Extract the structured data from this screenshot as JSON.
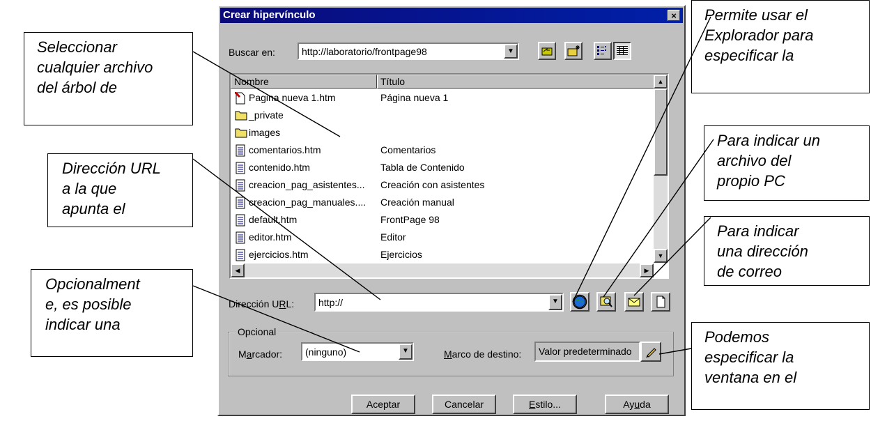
{
  "dialog": {
    "title": "Crear hipervínculo",
    "close_label": "×",
    "look_in_label": "Buscar en:",
    "look_in_value": "http://laboratorio/frontpage98",
    "toolbar_icons": [
      "up-folder-icon",
      "new-folder-icon",
      "list-view-icon",
      "details-view-icon"
    ],
    "columns": {
      "name": "Nombre",
      "title": "Título"
    },
    "files": [
      {
        "name": "Pagina nueva 1.htm",
        "title": "Página nueva 1",
        "icon": "page-icon"
      },
      {
        "name": "_private",
        "title": "",
        "icon": "folder-icon"
      },
      {
        "name": "images",
        "title": "",
        "icon": "folder-icon"
      },
      {
        "name": "comentarios.htm",
        "title": "Comentarios",
        "icon": "document-icon"
      },
      {
        "name": "contenido.htm",
        "title": "Tabla de Contenido",
        "icon": "document-icon"
      },
      {
        "name": "creacion_pag_asistentes...",
        "title": "Creación con asistentes",
        "icon": "document-icon"
      },
      {
        "name": "creacion_pag_manuales....",
        "title": "Creación manual",
        "icon": "document-icon"
      },
      {
        "name": "default.htm",
        "title": "FrontPage 98",
        "icon": "document-icon"
      },
      {
        "name": "editor.htm",
        "title": "Editor",
        "icon": "document-icon"
      },
      {
        "name": "ejercicios.htm",
        "title": "Ejercicios",
        "icon": "document-icon"
      }
    ],
    "url_label_pre": "Dirección U",
    "url_label_ul": "R",
    "url_label_post": "L:",
    "url_value": "http://",
    "optional_legend": "Opcional",
    "bookmark_label_pre": "M",
    "bookmark_label_ul": "a",
    "bookmark_label_post": "rcador:",
    "bookmark_value": "(ninguno)",
    "target_label_ul": "M",
    "target_label_post": "arco de destino:",
    "target_value": "Valor predeterminado",
    "buttons": {
      "ok": "Aceptar",
      "cancel": "Cancelar",
      "style_ul": "E",
      "style_post": "stilo...",
      "help_pre": "Ay",
      "help_ul": "u",
      "help_post": "da"
    }
  },
  "callouts": {
    "select_file": [
      "Seleccionar",
      "cualquier archivo",
      "del árbol de"
    ],
    "url": [
      "Dirección URL",
      "a la que",
      "apunta el"
    ],
    "optional": [
      "Opcionalment",
      "e, es posible",
      "indicar una"
    ],
    "browser": [
      "Permite usar el",
      "Explorador para",
      "especificar la"
    ],
    "local_file": [
      "Para indicar un",
      "archivo del",
      "propio PC"
    ],
    "email": [
      "Para indicar",
      "una dirección",
      "de correo"
    ],
    "target": [
      "Podemos",
      "especificar la",
      "ventana en el"
    ]
  }
}
